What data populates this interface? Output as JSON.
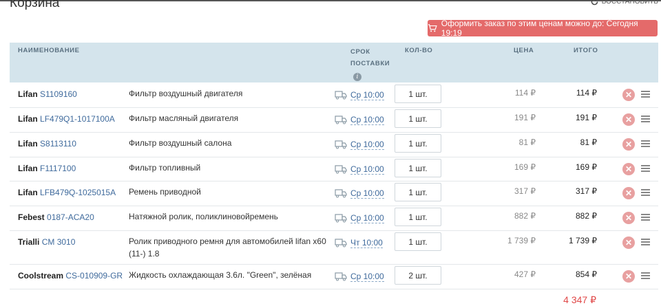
{
  "page": {
    "title": "Корзина",
    "restore_label": "Восстановить"
  },
  "deadline_banner": {
    "text": "Оформить заказ по этим ценам можно до: Сегодня 19:19"
  },
  "columns": {
    "name": "НАИМЕНОВАНИЕ",
    "delivery_line1": "СРОК",
    "delivery_line2": "ПОСТАВКИ",
    "qty": "КОЛ-ВО",
    "price": "ЦЕНА",
    "total": "ИТОГО"
  },
  "rows": [
    {
      "brand": "Lifan",
      "article": "S1109160",
      "name": "Фильтр воздушный двигателя",
      "delivery": "Ср 10:00",
      "qty": "1 шт.",
      "price": "114 ₽",
      "total": "114 ₽"
    },
    {
      "brand": "Lifan",
      "article": "LF479Q1-1017100A",
      "name": "Фильтр масляный двигателя",
      "delivery": "Ср 10:00",
      "qty": "1 шт.",
      "price": "191 ₽",
      "total": "191 ₽"
    },
    {
      "brand": "Lifan",
      "article": "S8113110",
      "name": "Фильтр воздушный салона",
      "delivery": "Ср 10:00",
      "qty": "1 шт.",
      "price": "81 ₽",
      "total": "81 ₽"
    },
    {
      "brand": "Lifan",
      "article": "F1117100",
      "name": "Фильтр топливный",
      "delivery": "Ср 10:00",
      "qty": "1 шт.",
      "price": "169 ₽",
      "total": "169 ₽"
    },
    {
      "brand": "Lifan",
      "article": "LFB479Q-1025015A",
      "name": "Ремень приводной",
      "delivery": "Ср 10:00",
      "qty": "1 шт.",
      "price": "317 ₽",
      "total": "317 ₽"
    },
    {
      "brand": "Febest",
      "article": "0187-ACA20",
      "name": "Натяжной ролик, поликлиновойремень",
      "delivery": "Ср 10:00",
      "qty": "1 шт.",
      "price": "882 ₽",
      "total": "882 ₽"
    },
    {
      "brand": "Trialli",
      "article": "CM 3010",
      "name": "Ролик приводного ремня для автомобилей lifan x60 (11-) 1.8",
      "delivery": "Чт 10:00",
      "qty": "1 шт.",
      "price": "1 739 ₽",
      "total": "1 739 ₽"
    },
    {
      "brand": "Coolstream",
      "article": "CS-010909-GR",
      "name": "Жидкость охлаждающая 3.6л. \"Green\", зелёная",
      "delivery": "Ср 10:00",
      "qty": "2 шт.",
      "price": "427 ₽",
      "total": "854 ₽"
    }
  ],
  "grand_total": "4 347 ₽",
  "colors": {
    "accent_red": "#e46a6a",
    "header_bg": "#d4e4ec",
    "link_blue": "#3f6a9c"
  }
}
